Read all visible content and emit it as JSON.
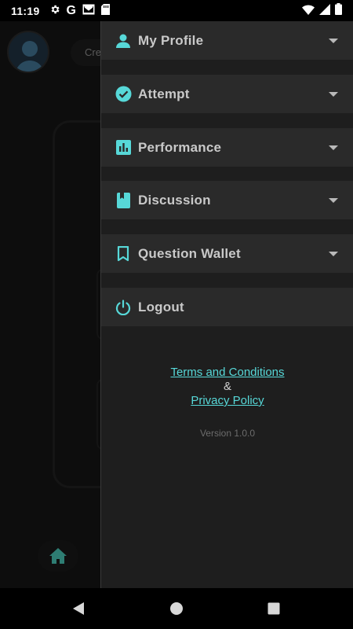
{
  "status_bar": {
    "time": "11:19",
    "left_icons": [
      "gear-icon",
      "google-icon",
      "mail-icon",
      "sd-card-icon"
    ],
    "right_icons": [
      "wifi-icon",
      "signal-icon",
      "battery-icon"
    ],
    "google_letter": "G"
  },
  "background": {
    "search_pill_text": "Cre"
  },
  "drawer": {
    "items": [
      {
        "label": "My Profile",
        "icon": "person-icon",
        "expandable": true
      },
      {
        "label": "Attempt",
        "icon": "check-circle-icon",
        "expandable": true
      },
      {
        "label": "Performance",
        "icon": "bar-chart-icon",
        "expandable": true
      },
      {
        "label": "Discussion",
        "icon": "book-icon",
        "expandable": true
      },
      {
        "label": "Question Wallet",
        "icon": "bookmark-icon",
        "expandable": true
      },
      {
        "label": "Logout",
        "icon": "power-icon",
        "expandable": false
      }
    ],
    "terms_link": "Terms and Conditions",
    "ampersand": "&",
    "privacy_link": "Privacy Policy",
    "version": "Version 1.0.0"
  },
  "colors": {
    "accent": "#57d8d8",
    "drawer_bg": "#1e1e1e",
    "item_bg": "#2a2a2a",
    "text": "#c9c9c9"
  }
}
